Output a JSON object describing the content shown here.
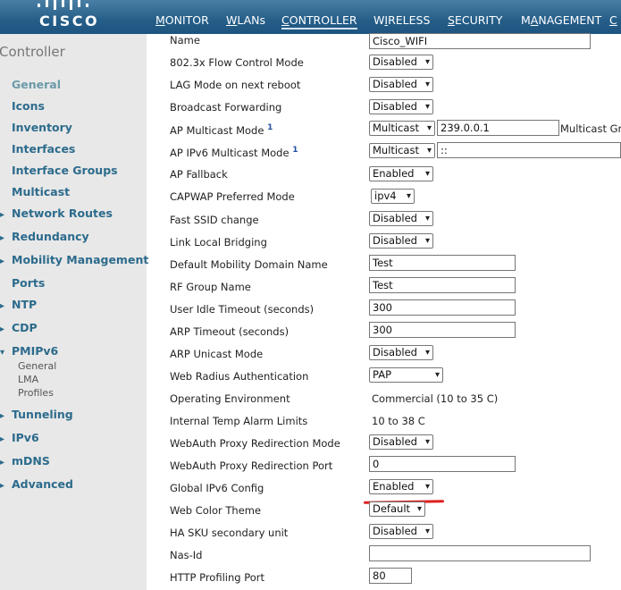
{
  "header": {
    "brand": "CISCO",
    "nav": [
      {
        "prefix": "",
        "ul": "M",
        "rest": "ONITOR"
      },
      {
        "prefix": "",
        "ul": "W",
        "rest": "LANs"
      },
      {
        "prefix": "",
        "ul": "C",
        "rest": "ONTROLLER"
      },
      {
        "prefix": "W",
        "ul": "I",
        "rest": "RELESS"
      },
      {
        "prefix": "",
        "ul": "S",
        "rest": "ECURITY"
      },
      {
        "prefix": "M",
        "ul": "A",
        "rest": "NAGEMENT"
      },
      {
        "prefix": "",
        "ul": "C",
        "rest": ""
      }
    ]
  },
  "sidebar": {
    "title": "Controller",
    "items": [
      "General",
      "Icons",
      "Inventory",
      "Interfaces",
      "Interface Groups",
      "Multicast",
      "Network Routes",
      "Redundancy",
      "Mobility Management",
      "Ports",
      "NTP",
      "CDP",
      "PMIPv6",
      "Tunneling",
      "IPv6",
      "mDNS",
      "Advanced"
    ],
    "pmipv6_sub": [
      "General",
      "LMA",
      "Profiles"
    ]
  },
  "form": {
    "name_label": "Name",
    "name_value": "Cisco_WIFI",
    "flow_label": "802.3x Flow Control Mode",
    "flow_value": "Disabled",
    "lag_label": "LAG Mode on next reboot",
    "lag_value": "Disabled",
    "bcast_label": "Broadcast Forwarding",
    "bcast_value": "Disabled",
    "apmc_label": "AP Multicast Mode",
    "apmc_sup": "1",
    "apmc_value": "Multicast",
    "apmc_ip": "239.0.0.1",
    "apmc_group": "Multicast Group Address",
    "apv6_label": "AP IPv6 Multicast Mode",
    "apv6_sup": "1",
    "apv6_value": "Multicast",
    "apv6_ip": "::",
    "fallback_label": "AP Fallback",
    "fallback_value": "Enabled",
    "capwap_label": "CAPWAP Preferred Mode",
    "capwap_value": "ipv4",
    "ssid_label": "Fast SSID change",
    "ssid_value": "Disabled",
    "llb_label": "Link Local Bridging",
    "llb_value": "Disabled",
    "mobility_label": "Default Mobility Domain Name",
    "mobility_value": "Test",
    "rf_label": "RF Group Name",
    "rf_value": "Test",
    "idle_label": "User Idle Timeout (seconds)",
    "idle_value": "300",
    "arp_label": "ARP Timeout (seconds)",
    "arp_value": "300",
    "arpu_label": "ARP Unicast Mode",
    "arpu_value": "Disabled",
    "radius_label": "Web Radius Authentication",
    "radius_value": "PAP",
    "env_label": "Operating Environment",
    "env_value": "Commercial (10 to 35 C)",
    "temp_label": "Internal Temp Alarm Limits",
    "temp_value": "10 to 38 C",
    "proxymode_label": "WebAuth Proxy Redirection Mode",
    "proxymode_value": "Disabled",
    "proxyport_label": "WebAuth Proxy Redirection Port",
    "proxyport_value": "0",
    "ipv6_label": "Global IPv6 Config",
    "ipv6_value": "Enabled",
    "theme_label": "Web Color Theme",
    "theme_value": "Default",
    "ha_label": "HA SKU secondary unit",
    "ha_value": "Disabled",
    "nas_label": "Nas-Id",
    "nas_value": "",
    "http_label": "HTTP Profiling Port",
    "http_value": "80"
  },
  "colors": {
    "header_blue": "#255e88",
    "sidebar_link": "#2c6b8c",
    "highlight_red": "#e02020"
  }
}
